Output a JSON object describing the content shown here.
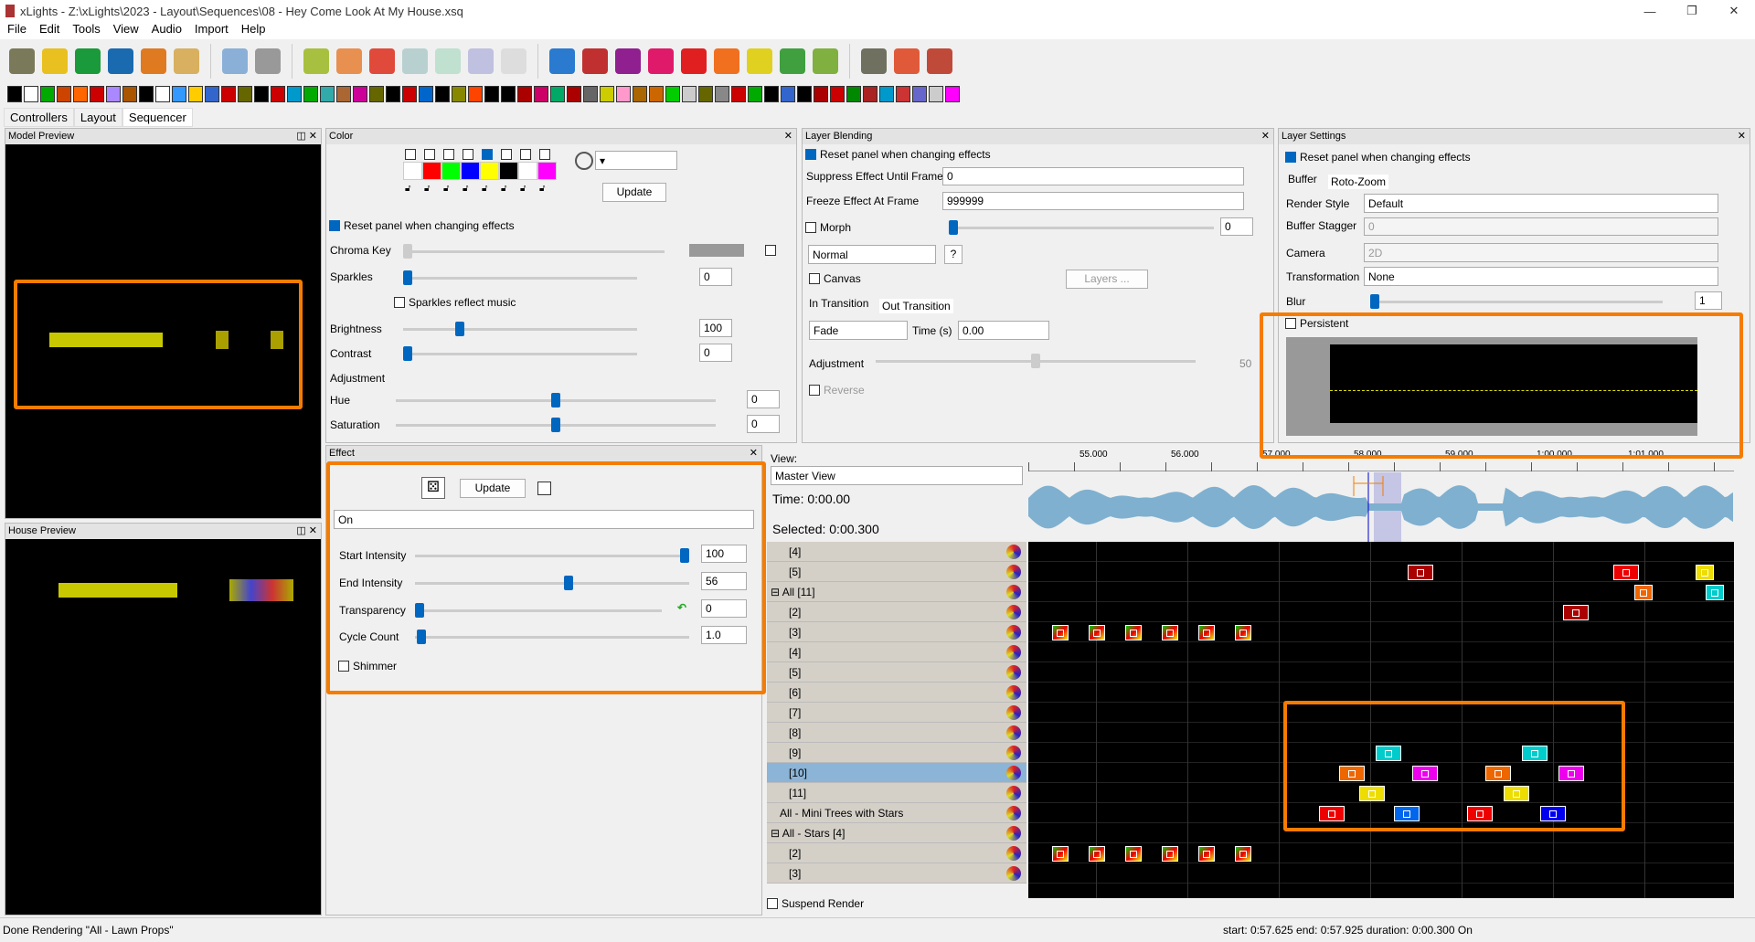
{
  "window": {
    "title": "xLights - Z:\\xLights\\2023 - Layout\\Sequences\\08 - Hey Come Look At My House.xsq",
    "min": "—",
    "max": "❐",
    "close": "✕"
  },
  "menu": [
    "File",
    "Edit",
    "Tools",
    "View",
    "Audio",
    "Import",
    "Help"
  ],
  "tabs": [
    "Controllers",
    "Layout",
    "Sequencer"
  ],
  "model_preview": {
    "title": "Model Preview"
  },
  "house_preview": {
    "title": "House Preview"
  },
  "color": {
    "title": "Color",
    "swatches": [
      "#ffffff",
      "#ff0000",
      "#00ff00",
      "#0000ff",
      "#ffff00",
      "#000000",
      "#ffffff",
      "#ff00ff"
    ],
    "checked_index": 4,
    "update": "Update",
    "reset": "Reset panel when changing effects",
    "chroma_key": "Chroma Key",
    "sparkles": "Sparkles",
    "sparkles_value": "0",
    "sparkles_music": "Sparkles reflect music",
    "brightness": "Brightness",
    "brightness_value": "100",
    "contrast": "Contrast",
    "contrast_value": "0",
    "adjustment": "Adjustment",
    "hue": "Hue",
    "hue_value": "0",
    "saturation": "Saturation",
    "saturation_value": "0"
  },
  "blending": {
    "title": "Layer Blending",
    "reset": "Reset panel when changing effects",
    "suppress": "Suppress Effect Until Frame",
    "suppress_value": "0",
    "freeze": "Freeze Effect At Frame",
    "freeze_value": "999999",
    "morph": "Morph",
    "morph_value": "0",
    "mode": "Normal",
    "help": "?",
    "canvas": "Canvas",
    "layers": "Layers ...",
    "in_tab": "In Transition",
    "out_tab": "Out Transition",
    "transition": "Fade",
    "time_label": "Time (s)",
    "time_value": "0.00",
    "adjustment": "Adjustment",
    "adjustment_value": "50",
    "reverse": "Reverse"
  },
  "layer_settings": {
    "title": "Layer Settings",
    "reset": "Reset panel when changing effects",
    "tab_buffer": "Buffer",
    "tab_roto": "Roto-Zoom",
    "render_style": "Render Style",
    "render_style_value": "Default",
    "buffer_stagger": "Buffer Stagger",
    "buffer_stagger_value": "0",
    "camera": "Camera",
    "camera_value": "2D",
    "transformation": "Transformation",
    "transformation_value": "None",
    "blur": "Blur",
    "blur_value": "1",
    "persistent": "Persistent"
  },
  "effect": {
    "title": "Effect",
    "update": "Update",
    "effect_value": "On",
    "start_intensity": "Start Intensity",
    "start_intensity_value": "100",
    "end_intensity": "End Intensity",
    "end_intensity_value": "56",
    "transparency": "Transparency",
    "transparency_value": "0",
    "cycle_count": "Cycle Count",
    "cycle_count_value": "1.0",
    "shimmer": "Shimmer"
  },
  "sequencer": {
    "view_label": "View:",
    "view_value": "Master View",
    "time": "Time: 0:00.00",
    "selected": "Selected: 0:00.300",
    "ticks": [
      "55.000",
      "56.000",
      "57.000",
      "58.000",
      "59.000",
      "1:00.000",
      "1:01.000"
    ],
    "rows": [
      {
        "label": "[4]"
      },
      {
        "label": "[5]"
      },
      {
        "label": "All [11]",
        "group": true
      },
      {
        "label": "[2]"
      },
      {
        "label": "[3]"
      },
      {
        "label": "[4]"
      },
      {
        "label": "[5]"
      },
      {
        "label": "[6]"
      },
      {
        "label": "[7]"
      },
      {
        "label": "[8]"
      },
      {
        "label": "[9]"
      },
      {
        "label": "[10]",
        "selected": true
      },
      {
        "label": "[11]"
      },
      {
        "label": "All - Mini Trees with Stars",
        "top": true
      },
      {
        "label": "All - Stars [4]",
        "group": true
      },
      {
        "label": "[2]"
      },
      {
        "label": "[3]"
      }
    ],
    "suspend_render": "Suspend Render"
  },
  "status": {
    "left": "Done Rendering \"All - Lawn Props\"",
    "right": "start: 0:57.625 end: 0:57.925 duration: 0:00.300 On"
  },
  "colors": {
    "accent": "#0067c0",
    "highlight": "#f57c00",
    "waveform": "#7fb0cf",
    "selection": "#8cb4d6"
  }
}
